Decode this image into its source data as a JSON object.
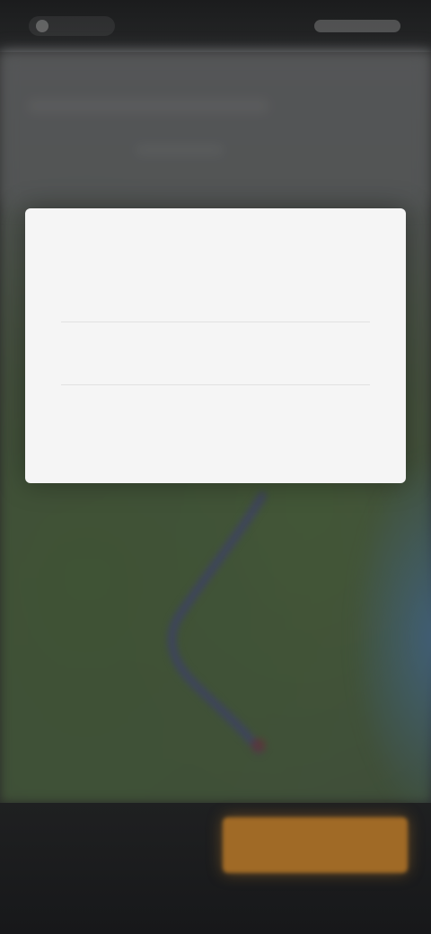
{
  "status_bar": {
    "left_icon": "app-icon",
    "right_icons": [
      "signal-icon",
      "wifi-icon",
      "battery-icon"
    ]
  },
  "dialog": {
    "title": "",
    "options": [
      "",
      ""
    ]
  },
  "bottom_bar": {
    "summary_text": "",
    "primary_button_label": "",
    "primary_button_color": "#a06a26"
  },
  "colors": {
    "map_land": "#4e6444",
    "map_water": "#4f7ea3",
    "route": "#4a4f86",
    "dialog_bg": "#f5f5f5"
  }
}
